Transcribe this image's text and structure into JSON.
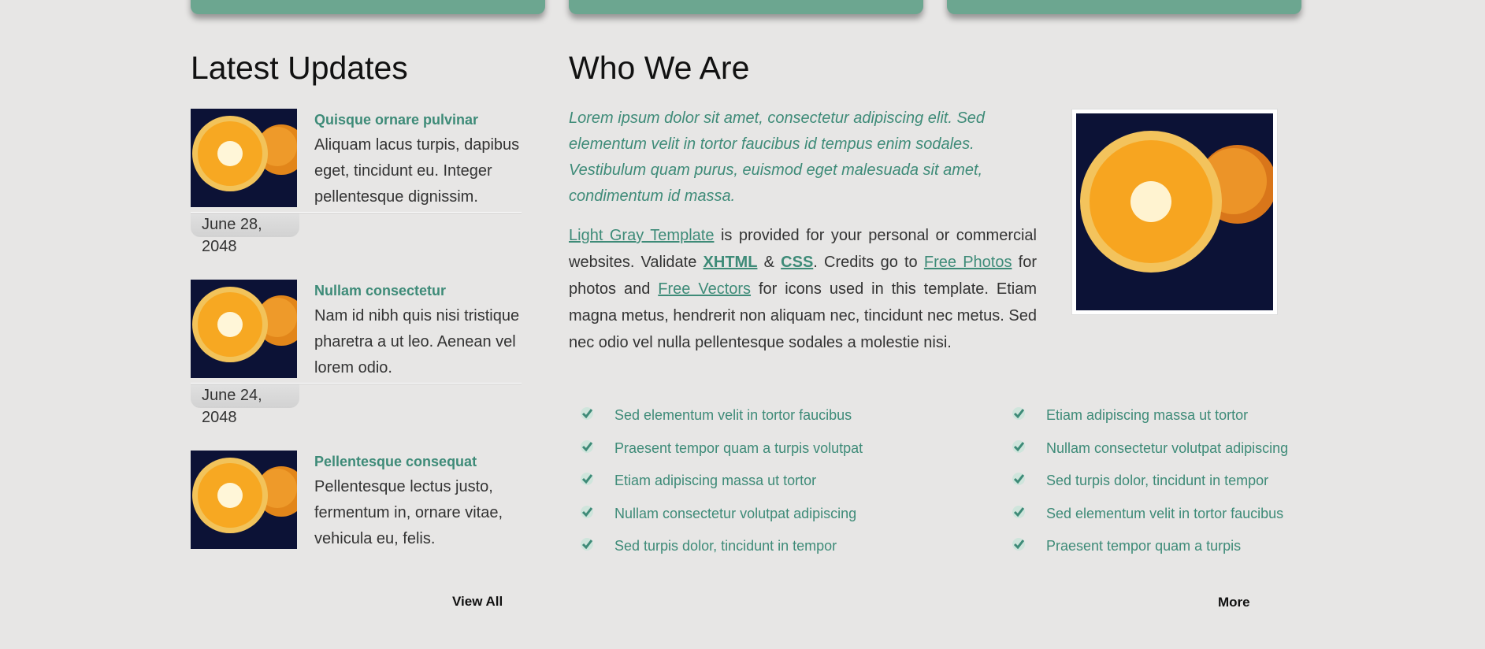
{
  "left_column": {
    "heading": "Latest Updates",
    "news": [
      {
        "title": "Quisque ornare pulvinar",
        "text": "Aliquam lacus turpis, dapibus eget, tincidunt eu. Integer pellentesque dignissim.",
        "date": "June 28, 2048"
      },
      {
        "title": "Nullam consectetur",
        "text": "Nam id nibh quis nisi tristique pharetra a ut leo. Aenean vel lorem odio.",
        "date": "June 24, 2048"
      },
      {
        "title": "Pellentesque consequat",
        "text": "Pellentesque lectus justo, fermentum in, ornare vitae, vehicula eu, felis."
      }
    ],
    "view_all": "View All"
  },
  "right_column": {
    "heading": "Who We Are",
    "intro": "Lorem ipsum dolor sit amet, consectetur adipiscing elit. Sed elementum velit in tortor faucibus id tempus enim sodales. Vestibulum quam purus, euismod eget malesuada sit amet, condimentum id massa.",
    "para": {
      "link1": "Light Gray Template",
      "t1": " is provided for your personal or commercial websites. Validate ",
      "xhtml": "XHTML",
      "t2": " & ",
      "css": "CSS",
      "t3": ". Credits go to ",
      "link2": "Free Photos",
      "t4": " for photos and ",
      "link3": "Free Vectors",
      "t5": " for icons used in this template. Etiam magna metus, hendrerit non aliquam nec, tincidunt nec metus. Sed nec odio vel nulla pellentesque sodales a molestie nisi."
    },
    "list_left": [
      "Sed elementum velit in tortor faucibus",
      "Praesent tempor quam a turpis volutpat",
      "Etiam adipiscing massa ut tortor",
      "Nullam consectetur volutpat adipiscing",
      "Sed turpis dolor, tincidunt in tempor"
    ],
    "list_right": [
      "Etiam adipiscing massa ut tortor",
      "Nullam consectetur volutpat adipiscing",
      "Sed turpis dolor, tincidunt in tempor",
      "Sed elementum velit in tortor faucibus",
      "Praesent tempor quam a turpis"
    ],
    "more": "More"
  },
  "colors": {
    "accent": "#3e8b78",
    "tab_green": "#6ca690",
    "background": "#e7e6e5"
  },
  "icons": {
    "check": "check-icon",
    "photo": "orange-photo"
  }
}
